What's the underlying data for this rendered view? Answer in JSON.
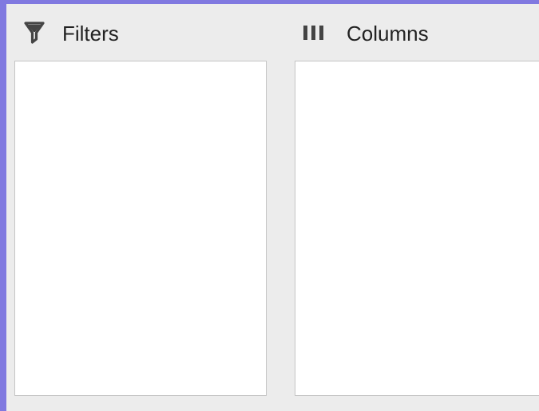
{
  "filters": {
    "icon": "funnel-icon",
    "label": "Filters"
  },
  "columns": {
    "icon": "columns-icon",
    "label": "Columns"
  },
  "colors": {
    "window_background": "#8079e0",
    "panel_background": "#ececec",
    "drop_zone_background": "#ffffff",
    "drop_zone_border": "#c4c4c4",
    "text": "#222222",
    "icon": "#444444"
  }
}
